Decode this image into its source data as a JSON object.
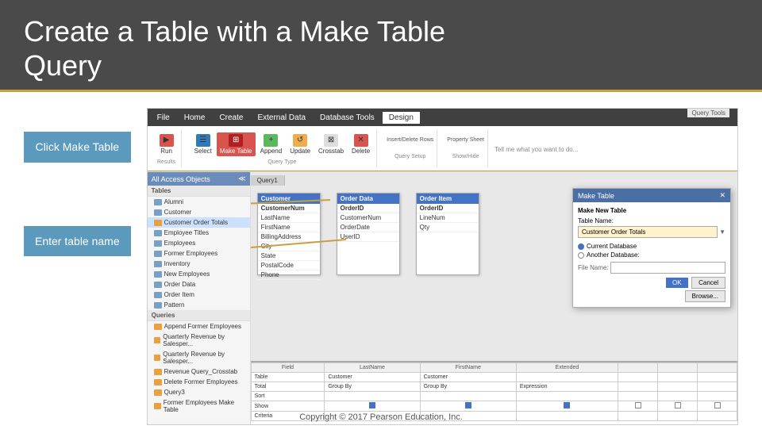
{
  "header": {
    "title_line1": "Create a Table with a Make Table",
    "title_line2": "Query",
    "underline_color": "#c8a040"
  },
  "callouts": {
    "click_make_table": "Click Make Table",
    "enter_table_name": "Enter table name"
  },
  "ribbon": {
    "tabs": [
      "File",
      "Home",
      "Create",
      "External Data",
      "Database Tools",
      "Design"
    ],
    "active_tab": "Design",
    "query_tools_label": "Query Tools",
    "tell_me_label": "Tell me what you want to do...",
    "groups": {
      "results": "Results",
      "query_type": "Query Type",
      "query_setup": "Query Setup",
      "show_hide": "Show/Hide"
    },
    "buttons": [
      "Run",
      "Select",
      "Make Table",
      "Append",
      "Update",
      "Crosstab",
      "Delete"
    ]
  },
  "nav_pane": {
    "header": "All Access Objects",
    "sections": {
      "tables": "Tables",
      "queries": "Queries"
    },
    "table_items": [
      "Alumni",
      "Customer",
      "Customer Order Totals",
      "Employee Titles",
      "Employees",
      "Former Employees",
      "Inventory",
      "New Employees",
      "Order Data",
      "Order Item",
      "Pattern"
    ],
    "query_items": [
      "Append Former Employees",
      "Quarterly Revenue by Salesper...",
      "Quarterly Revenue by Salesper...",
      "Revenue Query_Crosstab",
      "Delete Former Employees",
      "Query3",
      "Former Employees Make Table"
    ]
  },
  "query_tab": "Query1",
  "tables": {
    "customer": {
      "name": "Customer",
      "fields": [
        "CustomerNum",
        "LastName",
        "FirstName",
        "BillingAddress",
        "City",
        "State",
        "PostalCode",
        "Phone"
      ]
    },
    "order_data": {
      "name": "Order Data",
      "fields": [
        "OrderID",
        "CustomerNum",
        "OrderDate",
        "UserID"
      ]
    },
    "order_item": {
      "name": "Order Item",
      "fields": [
        "OrderID",
        "LineNum",
        "Qty"
      ]
    }
  },
  "dialog": {
    "title": "Make Table",
    "make_new_table_label": "Make New Table",
    "table_name_label": "Table Name:",
    "table_name_value": "Customer Order Totals",
    "current_database": "Current Database",
    "another_database": "Another Database:",
    "file_name_label": "File Name:",
    "ok_button": "OK",
    "cancel_button": "Cancel",
    "browse_button": "Browse..."
  },
  "query_grid": {
    "rows": {
      "field": [
        "LastName",
        "FirstName",
        "Extended",
        ""
      ],
      "table": [
        "Customer",
        "Customer",
        "",
        ""
      ],
      "total": [
        "Group By",
        "Group By",
        "Expression",
        ""
      ],
      "sort": [
        "",
        "",
        "",
        ""
      ],
      "show": [
        true,
        true,
        true,
        false
      ],
      "criteria": [
        "",
        "",
        "",
        ""
      ]
    }
  },
  "footer": {
    "copyright": "Copyright © 2017 Pearson Education, Inc."
  }
}
